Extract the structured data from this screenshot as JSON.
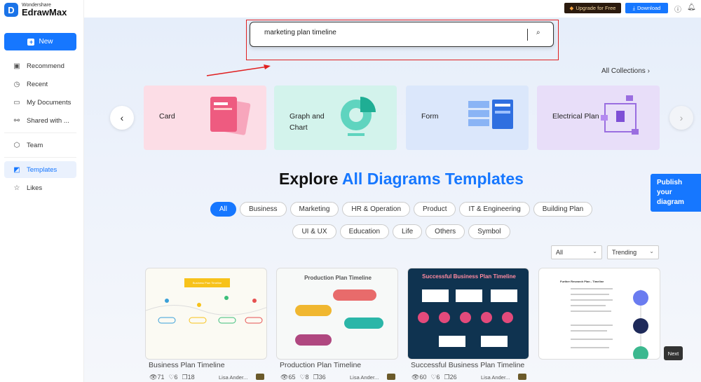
{
  "app": {
    "brand_small": "Wondershare",
    "brand": "EdrawMax"
  },
  "sidebar": {
    "new_label": "New",
    "items": [
      {
        "label": "Recommend",
        "icon": "recommend-icon"
      },
      {
        "label": "Recent",
        "icon": "clock-icon"
      },
      {
        "label": "My Documents",
        "icon": "folder-icon"
      },
      {
        "label": "Shared with ...",
        "icon": "share-icon"
      },
      {
        "label": "Team",
        "icon": "team-icon"
      },
      {
        "label": "Templates",
        "icon": "templates-icon",
        "active": true
      },
      {
        "label": "Likes",
        "icon": "star-icon"
      }
    ]
  },
  "topbar": {
    "upgrade": "Upgrade for Free",
    "download": "Download"
  },
  "search": {
    "value": "marketing plan timeline"
  },
  "all_collections": "All Collections",
  "categories": [
    {
      "label": "Card",
      "color": "#fcdde6"
    },
    {
      "label": "Graph and Chart",
      "color": "#d3f3ec"
    },
    {
      "label": "Form",
      "color": "#dbe7fb"
    },
    {
      "label": "Electrical Plan",
      "color": "#e8def9"
    }
  ],
  "heading": {
    "part1": "Explore",
    "part2": "All Diagrams Templates"
  },
  "filters_row1": [
    "All",
    "Business",
    "Marketing",
    "HR & Operation",
    "Product",
    "IT & Engineering",
    "Building Plan"
  ],
  "filters_row2": [
    "UI & UX",
    "Education",
    "Life",
    "Others",
    "Symbol"
  ],
  "dropdowns": {
    "type": "All",
    "sort": "Trending"
  },
  "templates": [
    {
      "title": "Business Plan Timeline",
      "views": "71",
      "likes": "6",
      "copies": "18",
      "author": "Lisa Ander...",
      "thumb_title": "Business Plan Timeline"
    },
    {
      "title": "Production Plan Timeline",
      "views": "65",
      "likes": "8",
      "copies": "36",
      "author": "Lisa Ander...",
      "thumb_title": "Production Plan Timeline"
    },
    {
      "title": "Successful Business Plan Timeline",
      "views": "60",
      "likes": "6",
      "copies": "26",
      "author": "Lisa Ander...",
      "thumb_title": "Successful Business Plan Timeline"
    },
    {
      "title": "",
      "thumb_title": "Further Research Plan - Timeline"
    }
  ],
  "publish": "Publish your diagram",
  "next_tooltip": "Next",
  "colors": {
    "accent": "#1677ff",
    "highlight": "#e02020"
  }
}
